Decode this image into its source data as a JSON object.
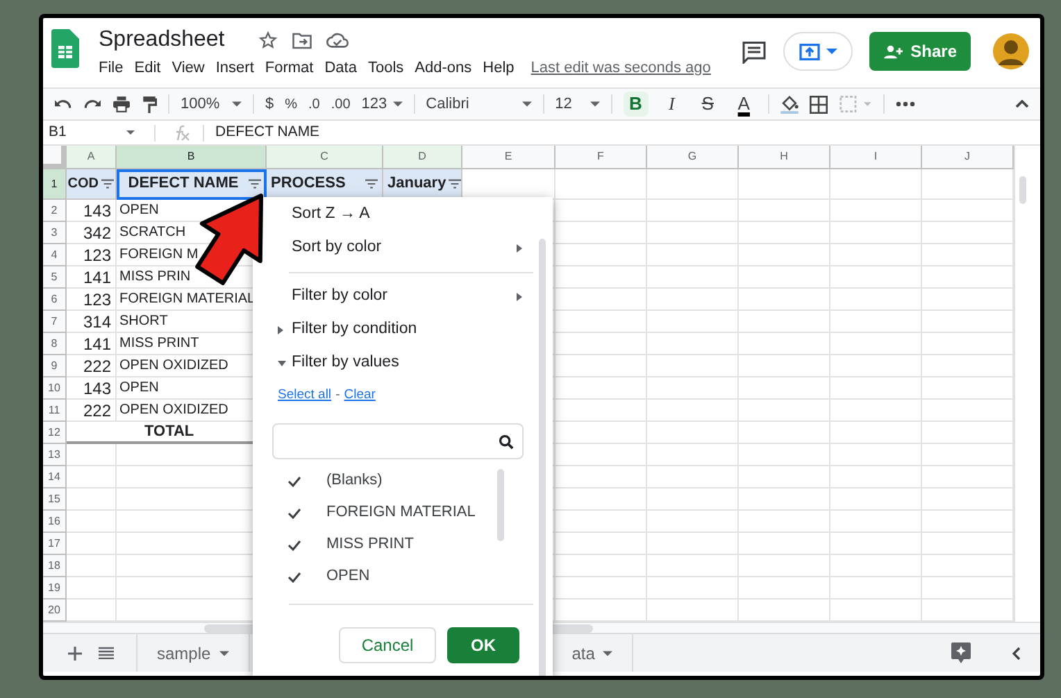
{
  "app": {
    "title": "Spreadsheet",
    "menu": [
      "File",
      "Edit",
      "View",
      "Insert",
      "Format",
      "Data",
      "Tools",
      "Add-ons",
      "Help"
    ],
    "last_edit": "Last edit was seconds ago",
    "share": "Share"
  },
  "toolbar": {
    "zoom": "100%",
    "currency": "$",
    "percent": "%",
    "decimal_decrease": ".0",
    "decimal_increase": ".00",
    "number_format": "123",
    "font": "Calibri",
    "font_size": "12",
    "format_buttons": [
      {
        "label": "B",
        "kind": "bold",
        "on": true
      },
      {
        "label": "I",
        "kind": "italic",
        "on": false
      },
      {
        "label": "S",
        "kind": "strike",
        "on": false
      },
      {
        "label": "A",
        "kind": "color",
        "on": false
      }
    ]
  },
  "formula_bar": {
    "cell_ref": "B1",
    "content": "DEFECT NAME"
  },
  "grid": {
    "columns": [
      {
        "label": "A",
        "selected": false
      },
      {
        "label": "B",
        "selected": true
      },
      {
        "label": "C",
        "selected": false
      },
      {
        "label": "D",
        "selected": false
      },
      {
        "label": "E",
        "selected": false
      },
      {
        "label": "F",
        "selected": false
      },
      {
        "label": "G",
        "selected": false
      },
      {
        "label": "H",
        "selected": false
      },
      {
        "label": "I",
        "selected": false
      },
      {
        "label": "J",
        "selected": false
      }
    ],
    "rows": [
      {
        "number": "1",
        "kind": "header",
        "cells": [
          "COD",
          "DEFECT NAME",
          "PROCESS",
          "January"
        ]
      },
      {
        "number": "2",
        "kind": "data",
        "cells": [
          "143",
          "OPEN"
        ]
      },
      {
        "number": "3",
        "kind": "data",
        "cells": [
          "342",
          "SCRATCH"
        ]
      },
      {
        "number": "4",
        "kind": "data",
        "cells": [
          "123",
          "FOREIGN M"
        ]
      },
      {
        "number": "5",
        "kind": "data",
        "cells": [
          "141",
          "MISS PRIN"
        ]
      },
      {
        "number": "6",
        "kind": "data",
        "cells": [
          "123",
          "FOREIGN MATERIAL"
        ]
      },
      {
        "number": "7",
        "kind": "data",
        "cells": [
          "314",
          "SHORT"
        ]
      },
      {
        "number": "8",
        "kind": "data",
        "cells": [
          "141",
          "MISS PRINT"
        ]
      },
      {
        "number": "9",
        "kind": "data",
        "cells": [
          "222",
          "OPEN OXIDIZED"
        ]
      },
      {
        "number": "10",
        "kind": "data",
        "cells": [
          "143",
          "OPEN"
        ]
      },
      {
        "number": "11",
        "kind": "data",
        "cells": [
          "222",
          "OPEN OXIDIZED"
        ]
      },
      {
        "number": "12",
        "kind": "total",
        "cells": [
          "",
          "TOTAL"
        ]
      },
      {
        "number": "13",
        "kind": "data",
        "cells": []
      },
      {
        "number": "14",
        "kind": "data",
        "cells": []
      },
      {
        "number": "15",
        "kind": "data",
        "cells": []
      },
      {
        "number": "16",
        "kind": "data",
        "cells": []
      },
      {
        "number": "17",
        "kind": "data",
        "cells": []
      },
      {
        "number": "18",
        "kind": "data",
        "cells": []
      },
      {
        "number": "19",
        "kind": "data",
        "cells": []
      },
      {
        "number": "20",
        "kind": "data",
        "cells": []
      }
    ]
  },
  "filter_menu": {
    "sort_items": [
      {
        "label": "Sort Z → A",
        "kind": "plain"
      },
      {
        "label": "Sort by color",
        "kind": "submenu"
      }
    ],
    "filter_items": [
      {
        "label": "Filter by color",
        "kind": "submenu"
      },
      {
        "label": "Filter by condition",
        "kind": "collapsed"
      },
      {
        "label": "Filter by values",
        "kind": "expanded"
      }
    ],
    "select_all": "Select all",
    "link_separator": "-",
    "clear": "Clear",
    "values": [
      {
        "label": "(Blanks)",
        "checked": true
      },
      {
        "label": "FOREIGN MATERIAL",
        "checked": true
      },
      {
        "label": "MISS PRINT",
        "checked": true
      },
      {
        "label": "OPEN",
        "checked": true
      }
    ],
    "cancel": "Cancel",
    "ok": "OK"
  },
  "sheet_tabs": [
    {
      "label": "sample",
      "selected": false
    },
    {
      "label": "ata",
      "selected": false
    }
  ]
}
